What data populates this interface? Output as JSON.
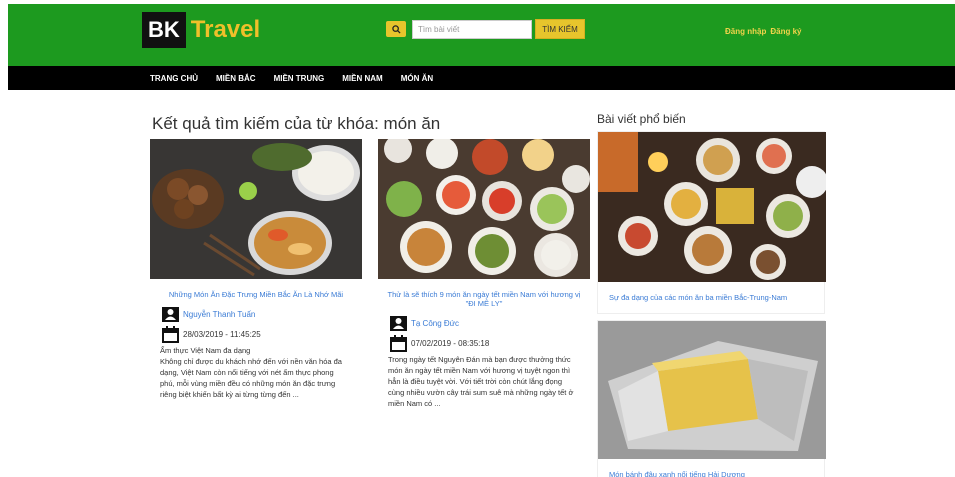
{
  "header": {
    "logo_bk": "BK",
    "logo_travel": "Travel",
    "search_placeholder": "Tìm bài viết",
    "search_button": "TÌM KIẾM",
    "login": "Đăng nhập",
    "register": "Đăng ký"
  },
  "nav": {
    "items": [
      {
        "label": "TRANG CHỦ"
      },
      {
        "label": "MIỀN BẮC"
      },
      {
        "label": "MIỀN TRUNG"
      },
      {
        "label": "MIỀN NAM"
      },
      {
        "label": "MÓN ĂN"
      }
    ]
  },
  "main": {
    "heading": "Kết quả tìm kiếm của từ khóa: món ăn",
    "articles": [
      {
        "title": "Những Món Ăn Đặc Trưng Miền Bắc Ăn Là Nhớ Mãi",
        "author": "Nguyễn Thanh Tuấn",
        "date": "28/03/2019 - 11:45:25",
        "excerpt": "Ẩm thực Việt Nam đa dạng\nKhông chỉ được du khách nhớ đến với nền văn hóa đa dạng, Việt Nam còn nổi tiếng với nét ẩm thực phong phú, mỗi vùng miền đều có những món ăn đặc trưng riêng biệt khiến bất kỳ ai từng từng đến ..."
      },
      {
        "title": "Thử là sẽ thích 9 món ăn ngày tết miền Nam với hương vị \"ĐI MÊ LY\"",
        "author": "Tạ Công Đức",
        "date": "07/02/2019 - 08:35:18",
        "excerpt": "Trong ngày tết Nguyên Đán mà bạn được thưởng thức món ăn ngày tết miền Nam với hương vị tuyệt ngon thì hẳn là điều tuyệt vời. Với tiết trời còn chút lắng đọng cùng nhiều vườn cây trái sum suê mà những ngày tết ở miền Nam có ..."
      }
    ]
  },
  "sidebar": {
    "title": "Bài viết phổ biến",
    "posts": [
      {
        "caption": "Sự đa dạng của các món ăn ba miền Bắc-Trung-Nam"
      },
      {
        "caption": "Món bánh đậu xanh nổi tiếng Hải Dương"
      }
    ]
  },
  "colors": {
    "header_green": "#1d9a1f",
    "logo_yellow": "#f0c02a",
    "button_yellow": "#e7c52c",
    "link_blue": "#3a7bd5"
  },
  "icons": [
    "search-icon",
    "user-icon",
    "calendar-icon"
  ]
}
